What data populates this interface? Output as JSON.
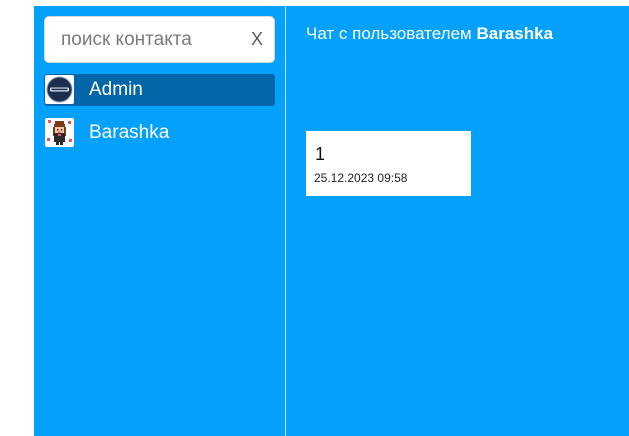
{
  "search": {
    "placeholder": "поиск контакта",
    "value": "",
    "clear_label": "X"
  },
  "contacts": [
    {
      "name": "Admin",
      "avatar_icon": "admin-logo-icon",
      "active": true
    },
    {
      "name": "Barashka",
      "avatar_icon": "pixel-character-icon",
      "active": false
    }
  ],
  "chat": {
    "title_prefix": "Чат с пользователем",
    "title_user": "Barashka",
    "messages": [
      {
        "text": "1",
        "time": "25.12.2023 09:58"
      }
    ]
  },
  "colors": {
    "background": "#03a0fc",
    "active_contact": "#0266a8",
    "message_bubble": "#ffffff"
  }
}
